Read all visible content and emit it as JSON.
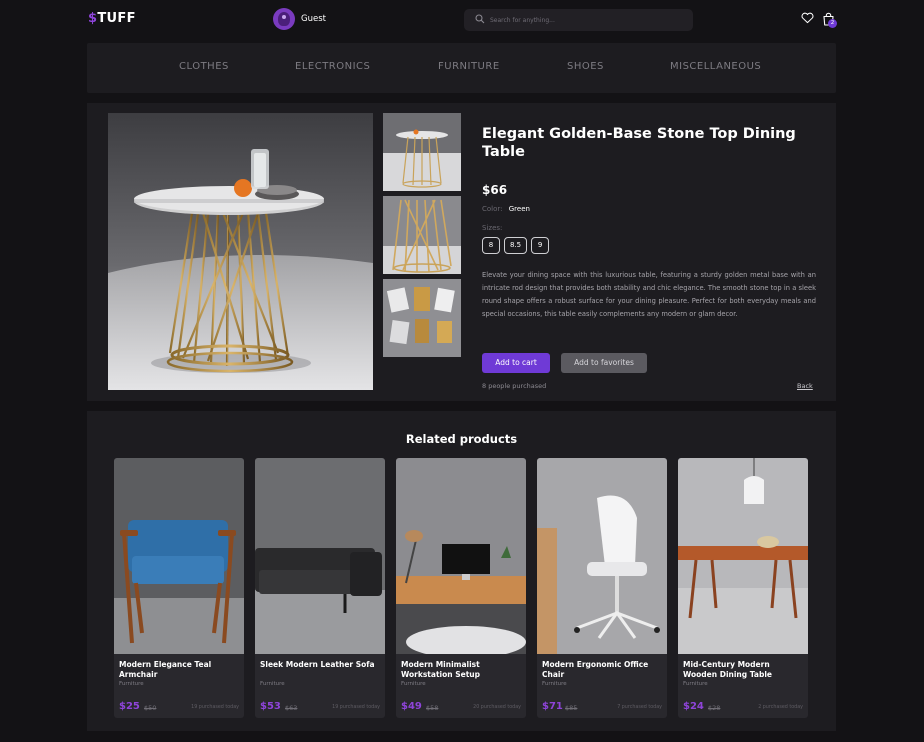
{
  "header": {
    "logo_symbol": "$",
    "logo_text": "TUFF",
    "user_name": "Guest",
    "search_placeholder": "Search for anything...",
    "cart_count": "2"
  },
  "categories": [
    "CLOTHES",
    "ELECTRONICS",
    "FURNITURE",
    "SHOES",
    "MISCELLANEOUS"
  ],
  "product": {
    "title": "Elegant Golden-Base Stone Top Dining Table",
    "price": "$66",
    "color_label": "Color:",
    "color_value": "Green",
    "sizes_label": "Sizes:",
    "sizes": [
      "8",
      "8.5",
      "9"
    ],
    "description": "Elevate your dining space with this luxurious table, featuring a sturdy golden metal base with an intricate rod design that provides both stability and chic elegance. The smooth stone top in a sleek round shape offers a robust surface for your dining pleasure. Perfect for both everyday meals and special occasions, this table easily complements any modern or glam decor.",
    "add_to_cart": "Add to cart",
    "add_to_favorites": "Add to favorites",
    "purchased_text": "8 people purchased",
    "back_label": "Back"
  },
  "related": {
    "title": "Related products",
    "items": [
      {
        "name": "Modern Elegance Teal Armchair",
        "category": "Furniture",
        "price": "$25",
        "old_price": "$50",
        "sold": "19 purchased today"
      },
      {
        "name": "Sleek Modern Leather Sofa",
        "category": "Furniture",
        "price": "$53",
        "old_price": "$63",
        "sold": "19 purchased today"
      },
      {
        "name": "Modern Minimalist Workstation Setup",
        "category": "Furniture",
        "price": "$49",
        "old_price": "$58",
        "sold": "20 purchased today"
      },
      {
        "name": "Modern Ergonomic Office Chair",
        "category": "Furniture",
        "price": "$71",
        "old_price": "$85",
        "sold": "7 purchased today"
      },
      {
        "name": "Mid-Century Modern Wooden Dining Table",
        "category": "Furniture",
        "price": "$24",
        "old_price": "$28",
        "sold": "2 purchased today"
      }
    ]
  }
}
